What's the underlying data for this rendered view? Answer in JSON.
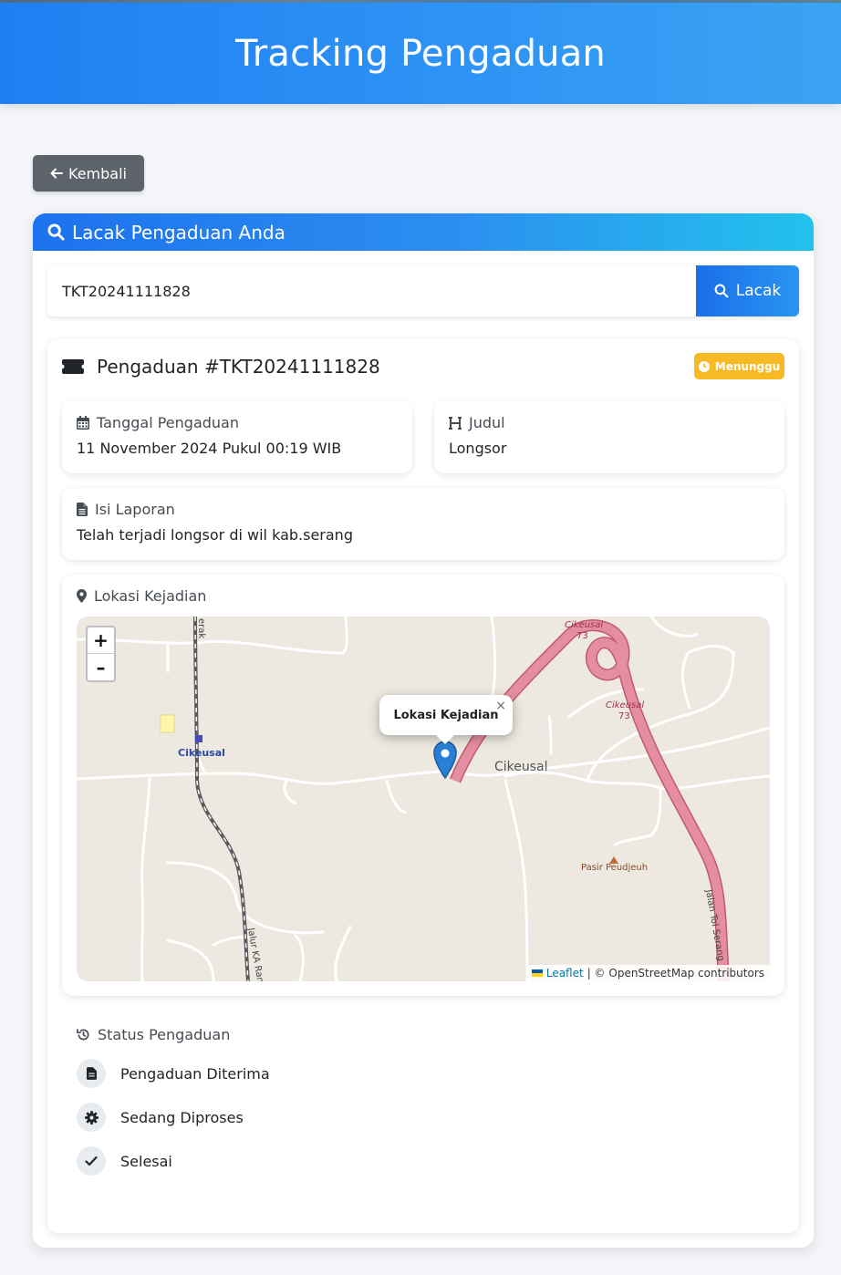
{
  "header": {
    "title": "Tracking Pengaduan"
  },
  "back_button": {
    "label": "Kembali",
    "icon": "arrow-left-icon"
  },
  "card": {
    "title": "Lacak Pengaduan Anda",
    "search": {
      "value": "TKT20241111828",
      "button_label": "Lacak"
    }
  },
  "ticket": {
    "heading": "Pengaduan #TKT20241111828",
    "status_badge": "Menunggu",
    "date_label": "Tanggal Pengaduan",
    "date_value": "11 November 2024 Pukul 00:19 WIB",
    "title_label": "Judul",
    "title_value": "Longsor",
    "report_label": "Isi Laporan",
    "report_value": "Telah terjadi longsor di wil kab.serang",
    "location_label": "Lokasi Kejadian"
  },
  "map": {
    "zoom_in": "+",
    "zoom_out": "–",
    "popup_text": "Lokasi Kejadian",
    "popup_close": "×",
    "labels": {
      "cikeusal_station": "Cikeusal",
      "cikeusal_town": "Cikeusal",
      "cikeusal_73_top": "Cikeusal",
      "num_73_top": "73",
      "cikeusal_73_right": "Cikeusal",
      "num_73_right": "73",
      "pasir": "Pasir Peudjeuh",
      "toll": "Jalan Tol Serang",
      "rail_top": "erak",
      "rail_bottom": "Jalur KA Ran"
    },
    "attribution_leaflet": "Leaflet",
    "attribution_rest": "| © OpenStreetMap contributors"
  },
  "status": {
    "title": "Status Pengaduan",
    "steps": [
      {
        "label": "Pengaduan Diterima",
        "icon": "file-icon"
      },
      {
        "label": "Sedang Diproses",
        "icon": "gear-icon"
      },
      {
        "label": "Selesai",
        "icon": "check-icon"
      }
    ]
  },
  "colors": {
    "header_blue": "#1f7ff2",
    "badge_warning": "#f7b924",
    "back_button": "#5c636a",
    "toll_road": "#e07a91"
  }
}
